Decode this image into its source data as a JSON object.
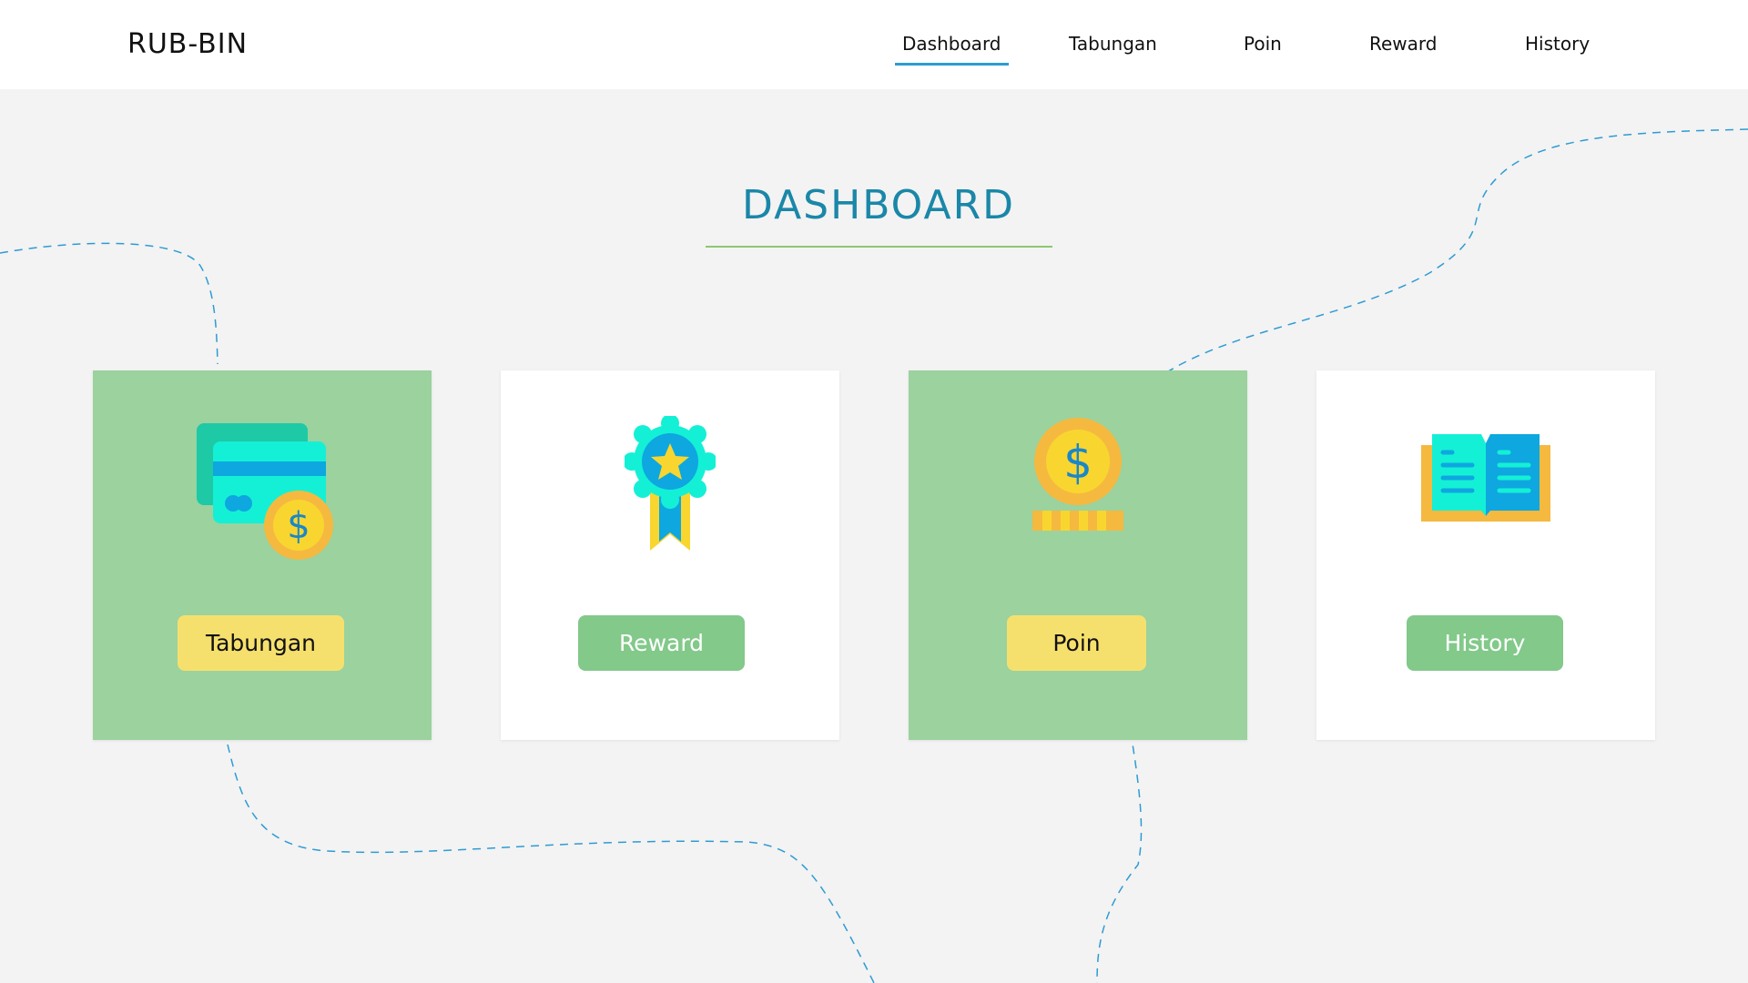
{
  "header": {
    "brand": "RUB-BIN",
    "nav": [
      {
        "label": "Dashboard",
        "active": true
      },
      {
        "label": "Tabungan",
        "active": false
      },
      {
        "label": "Poin",
        "active": false
      },
      {
        "label": "Reward",
        "active": false
      },
      {
        "label": "History",
        "active": false
      }
    ]
  },
  "main": {
    "title": "DASHBOARD",
    "cards": [
      {
        "label": "Tabungan",
        "icon": "credit-card-coin-icon"
      },
      {
        "label": "Reward",
        "icon": "award-ribbon-icon"
      },
      {
        "label": "Poin",
        "icon": "coin-stack-icon"
      },
      {
        "label": "History",
        "icon": "open-book-icon"
      }
    ]
  },
  "colors": {
    "title": "#1a87a8",
    "title_underline": "#8bc970",
    "nav_active_underline": "#2e9bd3",
    "card_green": "#9bd29e",
    "button_yellow": "#f6e06d",
    "button_green": "#82c98a",
    "background": "#f3f3f3"
  }
}
